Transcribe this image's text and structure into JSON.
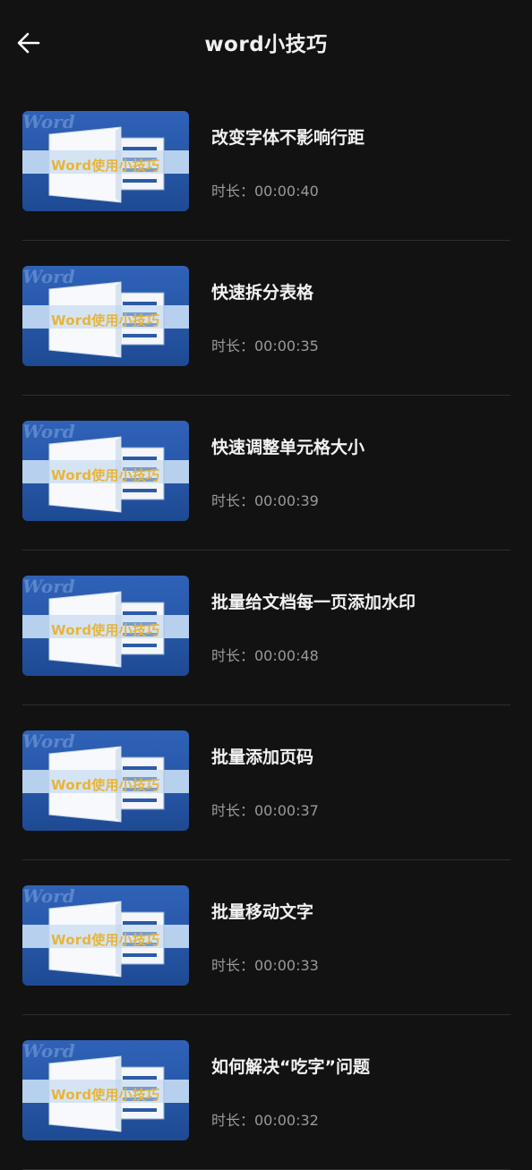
{
  "header": {
    "title": "word小技巧",
    "back_icon": "arrow-left-icon"
  },
  "thumbnail": {
    "logo_word": "Word",
    "caption": "Word使用小技巧",
    "doc_letter": "W",
    "colors": {
      "background": "#2a5aad",
      "band": "#b9d3ef",
      "caption": "#e6b53a"
    }
  },
  "items": [
    {
      "title": "改变字体不影响行距",
      "duration": "时长：00:00:40"
    },
    {
      "title": "快速拆分表格",
      "duration": "时长：00:00:35"
    },
    {
      "title": "快速调整单元格大小",
      "duration": "时长：00:00:39"
    },
    {
      "title": "批量给文档每一页添加水印",
      "duration": "时长：00:00:48"
    },
    {
      "title": "批量添加页码",
      "duration": "时长：00:00:37"
    },
    {
      "title": "批量移动文字",
      "duration": "时长：00:00:33"
    },
    {
      "title": "如何解决“吃字”问题",
      "duration": "时长：00:00:32"
    }
  ]
}
